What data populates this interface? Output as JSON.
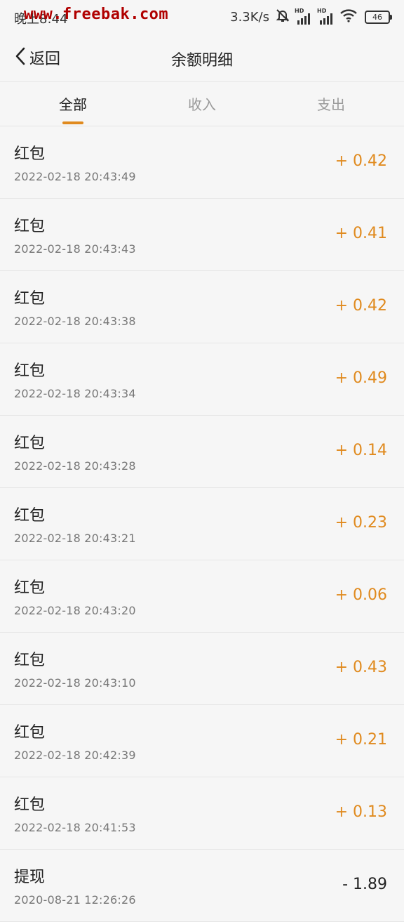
{
  "status_bar": {
    "time": "晚上8:44",
    "watermark": "www.freebak.com",
    "network_speed": "3.3K/s",
    "signal_1_label": "HD",
    "signal_2_label": "HD",
    "battery": "46"
  },
  "header": {
    "back_label": "返回",
    "title": "余额明细"
  },
  "tabs": [
    {
      "label": "全部",
      "active": true
    },
    {
      "label": "收入",
      "active": false
    },
    {
      "label": "支出",
      "active": false
    }
  ],
  "transactions": [
    {
      "title": "红包",
      "time": "2022-02-18 20:43:49",
      "amount": "+ 0.42"
    },
    {
      "title": "红包",
      "time": "2022-02-18 20:43:43",
      "amount": "+ 0.41"
    },
    {
      "title": "红包",
      "time": "2022-02-18 20:43:38",
      "amount": "+ 0.42"
    },
    {
      "title": "红包",
      "time": "2022-02-18 20:43:34",
      "amount": "+ 0.49"
    },
    {
      "title": "红包",
      "time": "2022-02-18 20:43:28",
      "amount": "+ 0.14"
    },
    {
      "title": "红包",
      "time": "2022-02-18 20:43:21",
      "amount": "+ 0.23"
    },
    {
      "title": "红包",
      "time": "2022-02-18 20:43:20",
      "amount": "+ 0.06"
    },
    {
      "title": "红包",
      "time": "2022-02-18 20:43:10",
      "amount": "+ 0.43"
    },
    {
      "title": "红包",
      "time": "2022-02-18 20:42:39",
      "amount": "+ 0.21"
    },
    {
      "title": "红包",
      "time": "2022-02-18 20:41:53",
      "amount": "+ 0.13"
    },
    {
      "title": "提现",
      "time": "2020-08-21 12:26:26",
      "amount": "- 1.89"
    }
  ],
  "colors": {
    "accent": "#e08a1e",
    "background": "#f6f6f6",
    "watermark": "#b00000"
  }
}
